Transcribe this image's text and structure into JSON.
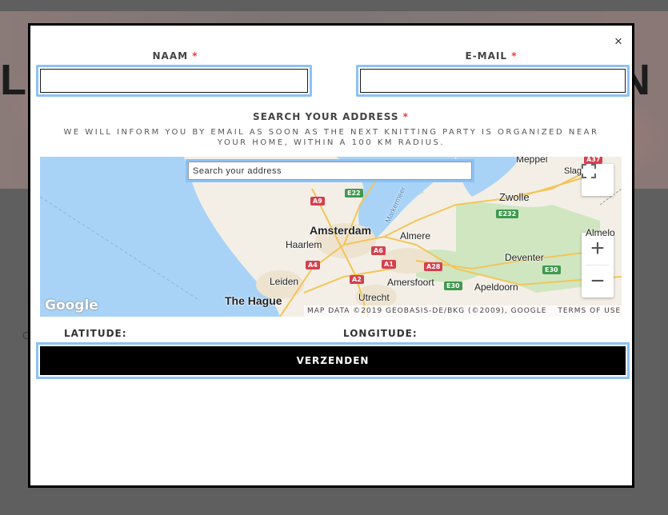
{
  "background": {
    "hero_left_letter": "L",
    "hero_right_letter": "N",
    "stub_left": "C",
    "stub_right": "."
  },
  "modal": {
    "close_glyph": "×",
    "fields": {
      "name_label": "NAAM",
      "name_value": "",
      "email_label": "E-MAIL",
      "email_value": "",
      "required_marker": "*",
      "address_label": "SEARCH YOUR ADDRESS"
    },
    "info_text": "WE WILL INFORM YOU BY EMAIL AS SOON AS THE NEXT KNITTING PARTY IS ORGANIZED NEAR YOUR HOME, WITHIN A 100 KM RADIUS.",
    "map": {
      "search_placeholder": "Search your address",
      "fullscreen_icon": "fullscreen-icon",
      "zoom_in": "+",
      "zoom_out": "−",
      "logo": "Google",
      "attribution": "MAP DATA ©2019 GEOBASIS-DE/BKG (©2009), GOOGLE",
      "terms": "TERMS OF USE",
      "cities": {
        "amsterdam": "Amsterdam",
        "haarlem": "Haarlem",
        "almere": "Almere",
        "zwolle": "Zwolle",
        "leiden": "Leiden",
        "the_hague": "The Hague",
        "utrecht": "Utrecht",
        "amersfoort": "Amersfoort",
        "apeldoorn": "Apeldoorn",
        "deventer": "Deventer",
        "meppel": "Meppel",
        "slag": "Slag",
        "almelo": "Almelo",
        "markermeer": "Markermeer"
      },
      "roads": {
        "a9": "A9",
        "e22": "E22",
        "a6": "A6",
        "a4": "A4",
        "a1": "A1",
        "a28": "A28",
        "a2": "A2",
        "e30": "E30",
        "e30b": "E30",
        "e232": "E232",
        "a37": "A37"
      }
    },
    "latitude_label": "LATITUDE:",
    "longitude_label": "LONGITUDE:",
    "submit_label": "VERZENDEN"
  }
}
